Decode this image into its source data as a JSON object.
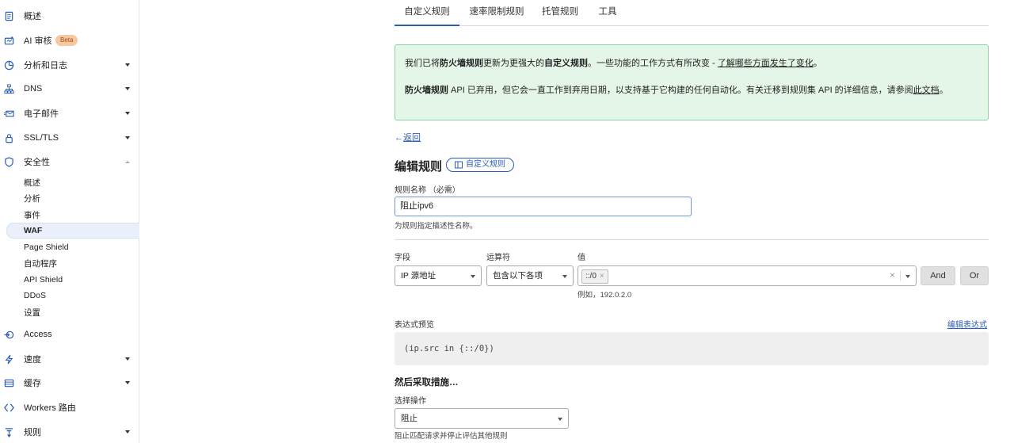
{
  "sidebar": {
    "items": [
      {
        "label": "概述",
        "icon": "document-icon"
      },
      {
        "label": "AI 审核",
        "icon": "ai-audit-icon",
        "badge": "Beta"
      },
      {
        "label": "分析和日志",
        "icon": "clock-chart-icon",
        "expandable": true
      },
      {
        "label": "DNS",
        "icon": "network-icon",
        "expandable": true
      },
      {
        "label": "电子邮件",
        "icon": "mail-icon",
        "expandable": true
      },
      {
        "label": "SSL/TLS",
        "icon": "lock-icon",
        "expandable": true
      },
      {
        "label": "安全性",
        "icon": "shield-icon",
        "expanded": true
      },
      {
        "label": "Access",
        "icon": "access-icon"
      },
      {
        "label": "速度",
        "icon": "lightning-icon",
        "expandable": true
      },
      {
        "label": "缓存",
        "icon": "cache-icon",
        "expandable": true
      },
      {
        "label": "Workers 路由",
        "icon": "workers-icon"
      },
      {
        "label": "规则",
        "icon": "rules-icon",
        "expandable": true
      }
    ],
    "security_sub": [
      "概述",
      "分析",
      "事件",
      "WAF",
      "Page Shield",
      "自动程序",
      "API Shield",
      "DDoS",
      "设置"
    ],
    "active_sub": "WAF"
  },
  "tabs": [
    "自定义规则",
    "速率限制规则",
    "托管规则",
    "工具"
  ],
  "active_tab": "自定义规则",
  "alert": {
    "p1_a": "我们已将",
    "p1_b": "防火墙规则",
    "p1_c": "更新为更强大的",
    "p1_d": "自定义规则",
    "p1_e": "。一些功能的工作方式有所改变 - ",
    "p1_link": "了解哪些方面发生了变化",
    "p1_end": "。",
    "p2_a": "防火墙规则",
    "p2_b": " API 已弃用，但它会一直工作到弃用日期，以支持基于它构建的任何自动化。有关迁移到规则集 API 的详细信息，请参阅",
    "p2_link": "此文档",
    "p2_end": "。"
  },
  "back": {
    "arrow": "←",
    "label": "返回"
  },
  "edit_title": "编辑规则",
  "rule_type_pill": "自定义规则",
  "rule_name": {
    "label": "规则名称 （必需）",
    "value": "阻止ipv6",
    "hint": "为规则指定描述性名称。"
  },
  "expression_builder": {
    "field_label": "字段",
    "operator_label": "运算符",
    "value_label": "值",
    "field": "IP 源地址",
    "operator": "包含以下各项",
    "value_tag": "::/0",
    "value_example": "例如，192.0.2.0",
    "and_label": "And",
    "or_label": "Or"
  },
  "expression_preview": {
    "label": "表达式预览",
    "edit_link": "编辑表达式",
    "code": "(ip.src in {::/0})"
  },
  "action": {
    "heading": "然后采取措施…",
    "label": "选择操作",
    "value": "阻止",
    "hint": "阻止匹配请求并停止评估其他规则"
  },
  "colors": {
    "accent": "#2c5db8",
    "alert_bg": "#e4f6e8",
    "alert_border": "#93d09f",
    "badge_bg": "#f6c9a3"
  }
}
